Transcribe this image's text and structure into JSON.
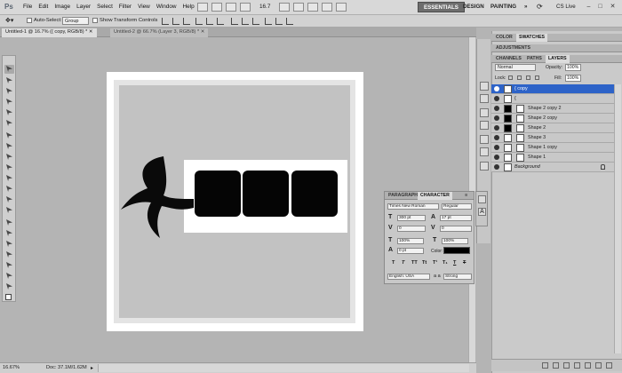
{
  "app": {
    "logo": "Ps",
    "menu": [
      "File",
      "Edit",
      "Image",
      "Layer",
      "Select",
      "Filter",
      "View",
      "Window",
      "Help"
    ],
    "zoom_readout": "16.7",
    "workspaces": [
      "ESSENTIALS",
      "DESIGN",
      "PAINTING"
    ],
    "workspace_more": "»",
    "cs_live": "CS Live",
    "window_controls": [
      "–",
      "□",
      "✕"
    ]
  },
  "options": {
    "auto_select_label": "Auto-Select:",
    "auto_select_value": "Group",
    "transform_label": "Show Transform Controls"
  },
  "tabs": [
    {
      "label": "Untitled-1 @ 16.7% ({ copy, RGB/8) *",
      "active": true
    },
    {
      "label": "Untitled-2 @ 66.7% (Layer 3, RGB/8) *",
      "active": false
    }
  ],
  "status": {
    "zoom": "16.67%",
    "doc": "Doc: 37.1M/1.62M"
  },
  "color_panel": {
    "tabs": [
      "COLOR",
      "SWATCHES"
    ]
  },
  "adjustments_panel": {
    "tabs": [
      "ADJUSTMENTS"
    ]
  },
  "layers_panel": {
    "tabs": [
      "CHANNELS",
      "PATHS",
      "LAYERS"
    ],
    "blend_mode": "Normal",
    "opacity_label": "Opacity:",
    "opacity": "100%",
    "lock_label": "Lock:",
    "fill_label": "Fill:",
    "fill": "100%",
    "layers": [
      {
        "name": "{ copy",
        "kind": "text",
        "selected": true
      },
      {
        "name": "{",
        "kind": "text",
        "selected": false
      },
      {
        "name": "Shape 2 copy 2",
        "kind": "shape",
        "selected": false
      },
      {
        "name": "Shape 2 copy",
        "kind": "shape",
        "selected": false
      },
      {
        "name": "Shape 2",
        "kind": "shape",
        "selected": false
      },
      {
        "name": "Shape 3",
        "kind": "shape",
        "selected": false
      },
      {
        "name": "Shape 1 copy",
        "kind": "shape",
        "selected": false
      },
      {
        "name": "Shape 1",
        "kind": "shape",
        "selected": false
      },
      {
        "name": "Background",
        "kind": "bg",
        "selected": false
      }
    ]
  },
  "character_panel": {
    "tabs": [
      "PARAGRAPH",
      "CHARACTER"
    ],
    "font_family": "Times New Roman",
    "font_style": "Regular",
    "font_size": "300 pt",
    "leading": "17 pt",
    "kerning": "0",
    "tracking": "0",
    "vertical_scale": "100%",
    "horizontal_scale": "100%",
    "baseline_shift": "0 pt",
    "color_label": "Color:",
    "language": "English: USA",
    "antialias": "Strong",
    "aa_label": "a a",
    "type_buttons": [
      "T",
      "T",
      "TT",
      "Tt",
      "T¹",
      "T₁",
      "T",
      "T"
    ]
  },
  "colors": {
    "selection": "#2d63c8",
    "workspace_active": "#6d6d6d"
  }
}
